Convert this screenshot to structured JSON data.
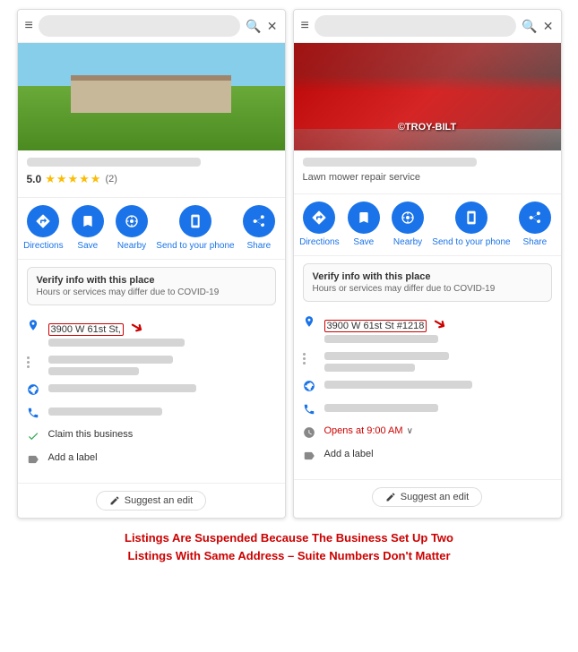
{
  "panels": [
    {
      "id": "left",
      "photo_type": "outdoor",
      "has_rating": true,
      "rating": "5.0",
      "stars": "★★★★★",
      "review_count": "(2)",
      "business_type": "",
      "address_highlight": "3900 W 61st St,",
      "actions": [
        {
          "label": "Directions",
          "icon": "◉"
        },
        {
          "label": "Save",
          "icon": "🔖"
        },
        {
          "label": "Nearby",
          "icon": "◎"
        },
        {
          "label": "Send to your phone",
          "icon": "📱"
        },
        {
          "label": "Share",
          "icon": "⬡"
        }
      ],
      "covid_title": "Verify info with this place",
      "covid_subtitle": "Hours or services may differ due to COVID-19",
      "claim_text": "Claim this business",
      "add_label_text": "Add a label",
      "suggest_edit": "Suggest an edit"
    },
    {
      "id": "right",
      "photo_type": "mower",
      "mower_logo": "©TROY-BILT",
      "has_rating": false,
      "business_type": "Lawn mower repair service",
      "address_highlight": "3900 W 61st St #1218",
      "opens_text": "Opens at 9:00 AM",
      "actions": [
        {
          "label": "Directions",
          "icon": "◉"
        },
        {
          "label": "Save",
          "icon": "🔖"
        },
        {
          "label": "Nearby",
          "icon": "◎"
        },
        {
          "label": "Send to your phone",
          "icon": "📱"
        },
        {
          "label": "Share",
          "icon": "⬡"
        }
      ],
      "covid_title": "Verify info with this place",
      "covid_subtitle": "Hours or services may differ due to COVID-19",
      "add_label_text": "Add a label",
      "suggest_edit": "Suggest an edit"
    }
  ],
  "caption": {
    "line1": "Listings Are Suspended Because The Business Set Up Two",
    "line2": "Listings With Same Address – Suite Numbers Don't Matter"
  },
  "icons": {
    "menu": "≡",
    "search": "🔍",
    "close": "✕",
    "directions": "◉",
    "save": "⊟",
    "nearby": "◎",
    "phone": "📱",
    "share": "⬡",
    "location_pin": "📍",
    "dots": "⋮",
    "globe": "🌐",
    "telephone": "📞",
    "clock": "🕐",
    "label": "⊡",
    "pencil": "✏",
    "checkmark": "✓"
  }
}
